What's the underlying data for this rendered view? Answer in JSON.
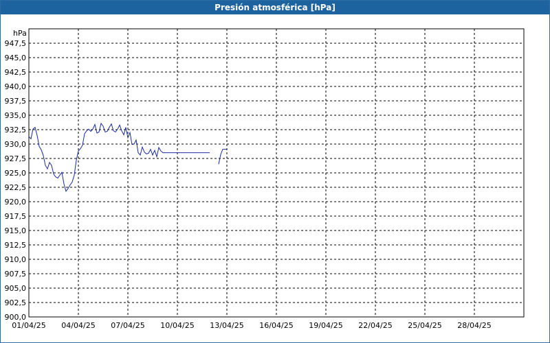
{
  "window": {
    "title": "Presión atmosférica [hPa]"
  },
  "colors": {
    "titlebar": "#1d63a0",
    "line": "#1a2aa0",
    "grid": "#000000"
  },
  "chart_data": {
    "type": "line",
    "title": "Presión atmosférica [hPa]",
    "ylabel": "hPa",
    "xlabel": "",
    "ylim": [
      900.0,
      950.0
    ],
    "xlim": [
      "2025-04-01",
      "2025-04-30"
    ],
    "grid": true,
    "y_ticks": [
      "900,0",
      "902,5",
      "905,0",
      "907,5",
      "910,0",
      "912,5",
      "915,0",
      "917,5",
      "920,0",
      "922,5",
      "925,0",
      "927,5",
      "930,0",
      "932,5",
      "935,0",
      "937,5",
      "940,0",
      "942,5",
      "945,0",
      "947,5"
    ],
    "x_ticks": [
      {
        "label": "01/04/25",
        "date": "2025-04-01"
      },
      {
        "label": "04/04/25",
        "date": "2025-04-04"
      },
      {
        "label": "07/04/25",
        "date": "2025-04-07"
      },
      {
        "label": "10/04/25",
        "date": "2025-04-10"
      },
      {
        "label": "13/04/25",
        "date": "2025-04-13"
      },
      {
        "label": "16/04/25",
        "date": "2025-04-16"
      },
      {
        "label": "19/04/25",
        "date": "2025-04-19"
      },
      {
        "label": "22/04/25",
        "date": "2025-04-22"
      },
      {
        "label": "25/04/25",
        "date": "2025-04-25"
      },
      {
        "label": "28/04/25",
        "date": "2025-04-28"
      }
    ],
    "series": [
      {
        "color": "#1a2aa0",
        "segments": [
          [
            [
              "2025-04-01T00:00",
              931.3
            ],
            [
              "2025-04-01T03:00",
              930.9
            ],
            [
              "2025-04-01T06:00",
              932.6
            ],
            [
              "2025-04-01T09:00",
              932.9
            ],
            [
              "2025-04-01T12:00",
              931.5
            ],
            [
              "2025-04-01T15:00",
              929.6
            ],
            [
              "2025-04-01T18:00",
              929.0
            ],
            [
              "2025-04-01T21:00",
              928.0
            ],
            [
              "2025-04-02T00:00",
              926.3
            ],
            [
              "2025-04-02T03:00",
              925.7
            ],
            [
              "2025-04-02T06:00",
              926.8
            ],
            [
              "2025-04-02T09:00",
              926.3
            ],
            [
              "2025-04-02T12:00",
              924.8
            ],
            [
              "2025-04-02T15:00",
              924.3
            ],
            [
              "2025-04-02T18:00",
              924.1
            ],
            [
              "2025-04-02T21:00",
              924.6
            ],
            [
              "2025-04-03T00:00",
              925.1
            ],
            [
              "2025-04-03T03:00",
              923.1
            ],
            [
              "2025-04-03T06:00",
              921.8
            ],
            [
              "2025-04-03T09:00",
              922.3
            ],
            [
              "2025-04-03T12:00",
              922.9
            ],
            [
              "2025-04-03T15:00",
              923.4
            ],
            [
              "2025-04-03T18:00",
              924.6
            ],
            [
              "2025-04-03T21:00",
              927.2
            ],
            [
              "2025-04-04T00:00",
              928.8
            ],
            [
              "2025-04-04T03:00",
              929.2
            ],
            [
              "2025-04-04T06:00",
              929.8
            ],
            [
              "2025-04-04T09:00",
              931.8
            ],
            [
              "2025-04-04T12:00",
              932.3
            ],
            [
              "2025-04-04T15:00",
              932.6
            ],
            [
              "2025-04-04T18:00",
              932.2
            ],
            [
              "2025-04-04T21:00",
              932.6
            ],
            [
              "2025-04-05T00:00",
              933.4
            ],
            [
              "2025-04-05T03:00",
              931.9
            ],
            [
              "2025-04-05T06:00",
              932.1
            ],
            [
              "2025-04-05T09:00",
              933.6
            ],
            [
              "2025-04-05T12:00",
              933.1
            ],
            [
              "2025-04-05T15:00",
              932.1
            ],
            [
              "2025-04-05T18:00",
              932.2
            ],
            [
              "2025-04-05T21:00",
              932.9
            ],
            [
              "2025-04-06T00:00",
              933.5
            ],
            [
              "2025-04-06T03:00",
              932.3
            ],
            [
              "2025-04-06T06:00",
              932.1
            ],
            [
              "2025-04-06T09:00",
              932.6
            ],
            [
              "2025-04-06T12:00",
              933.3
            ],
            [
              "2025-04-06T15:00",
              932.3
            ],
            [
              "2025-04-06T18:00",
              931.6
            ],
            [
              "2025-04-06T21:00",
              932.9
            ],
            [
              "2025-04-07T00:00",
              931.1
            ],
            [
              "2025-04-07T03:00",
              932.0
            ],
            [
              "2025-04-07T06:00",
              929.9
            ],
            [
              "2025-04-07T09:00",
              930.0
            ],
            [
              "2025-04-07T12:00",
              930.7
            ],
            [
              "2025-04-07T15:00",
              928.5
            ],
            [
              "2025-04-07T18:00",
              928.1
            ],
            [
              "2025-04-07T21:00",
              929.5
            ],
            [
              "2025-04-08T00:00",
              928.6
            ],
            [
              "2025-04-08T03:00",
              928.3
            ],
            [
              "2025-04-08T06:00",
              928.4
            ],
            [
              "2025-04-08T09:00",
              929.1
            ],
            [
              "2025-04-08T12:00",
              928.1
            ],
            [
              "2025-04-08T15:00",
              928.9
            ],
            [
              "2025-04-08T18:00",
              927.8
            ],
            [
              "2025-04-08T21:00",
              929.4
            ],
            [
              "2025-04-09T00:00",
              928.8
            ],
            [
              "2025-04-09T03:00",
              928.5
            ],
            [
              "2025-04-10T00:00",
              928.5
            ],
            [
              "2025-04-11T00:00",
              928.5
            ],
            [
              "2025-04-11T23:00",
              928.5
            ]
          ],
          [
            [
              "2025-04-12T12:00",
              926.5
            ],
            [
              "2025-04-12T15:00",
              928.2
            ],
            [
              "2025-04-12T18:00",
              929.1
            ],
            [
              "2025-04-12T21:00",
              929.1
            ],
            [
              "2025-04-13T00:00",
              929.1
            ]
          ]
        ]
      }
    ]
  }
}
